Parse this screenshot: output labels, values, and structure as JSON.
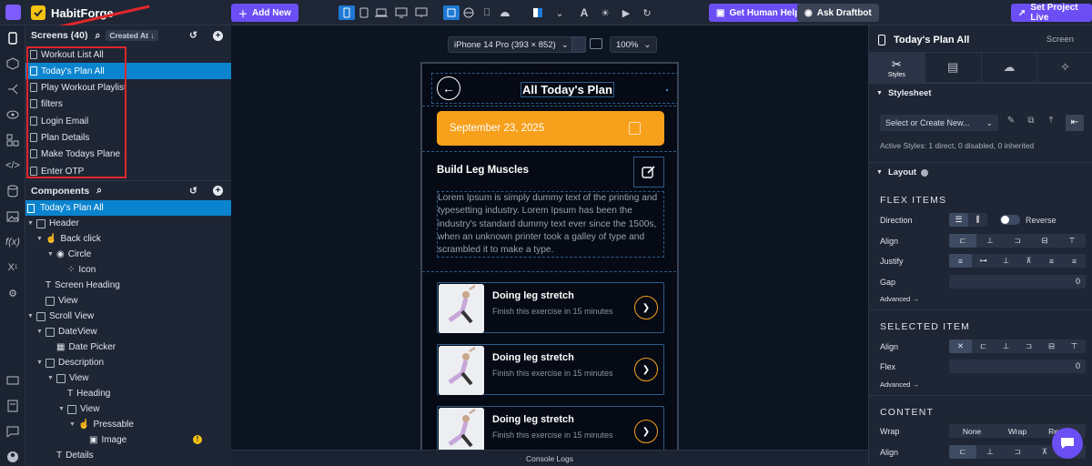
{
  "brand": {
    "name": "HabitForge"
  },
  "topbar": {
    "add_new": "Add New",
    "get_help": "Get Human Help",
    "ask_draftbot": "Ask Draftbot",
    "set_live": "Set Project Live"
  },
  "screens": {
    "title": "Screens (40)",
    "sort": "Created At ↓",
    "items": [
      "Workout List All",
      "Today's Plan All",
      "Play Workout Playlist",
      "filters",
      "Login Email",
      "Plan Details",
      "Make Todays Plane",
      "Enter OTP"
    ],
    "active_index": 1
  },
  "components": {
    "title": "Components",
    "tree": [
      {
        "label": "Today's Plan All"
      },
      {
        "label": "Header"
      },
      {
        "label": "Back click"
      },
      {
        "label": "Circle"
      },
      {
        "label": "Icon"
      },
      {
        "label": "Screen Heading"
      },
      {
        "label": "View"
      },
      {
        "label": "Scroll View"
      },
      {
        "label": "DateView"
      },
      {
        "label": "Date Picker"
      },
      {
        "label": "Description"
      },
      {
        "label": "View"
      },
      {
        "label": "Heading"
      },
      {
        "label": "View"
      },
      {
        "label": "Pressable"
      },
      {
        "label": "Image"
      },
      {
        "label": "Details"
      }
    ]
  },
  "canvas": {
    "device": "iPhone 14 Pro (393 × 852)",
    "zoom": "100%",
    "console": "Console Logs"
  },
  "phone": {
    "heading": "All Today's Plan",
    "date": "September 23, 2025",
    "desc_heading": "Build Leg Muscles",
    "details": "Lorem Ipsum is simply dummy text of the printing and typesetting industry. Lorem Ipsum has been the industry's standard dummy text ever since the 1500s, when an unknown printer took a galley of type and scrambled it to make a type.",
    "cards": [
      {
        "title": "Doing leg stretch",
        "subtitle": "Finish this exercise in 15 minutes"
      },
      {
        "title": "Doing leg stretch",
        "subtitle": "Finish this exercise in 15 minutes"
      },
      {
        "title": "Doing leg stretch",
        "subtitle": "Finish this exercise in 15 minutes"
      }
    ]
  },
  "right": {
    "title": "Today's Plan All",
    "tag": "Screen",
    "tab_styles": "Styles",
    "stylesheet": "Stylesheet",
    "select_create": "Select or Create New...",
    "active_styles": "Active Styles: 1 direct, 0 disabled, 0 inherited",
    "layout": "Layout",
    "flex_items": "FLEX ITEMS",
    "direction": "Direction",
    "reverse": "Reverse",
    "align": "Align",
    "justify": "Justify",
    "gap": "Gap",
    "gap_value": "0",
    "advanced": "Advanced →",
    "selected_item": "SELECTED ITEM",
    "flex": "Flex",
    "flex_value": "0",
    "content": "CONTENT",
    "wrap": "Wrap",
    "wrap_options": [
      "None",
      "Wrap",
      "Reverse"
    ]
  },
  "colors": {
    "accent": "#6c4ef5",
    "selected": "#0a84cf",
    "orange": "#f7a01c",
    "red_annotation": "#e0262b"
  }
}
